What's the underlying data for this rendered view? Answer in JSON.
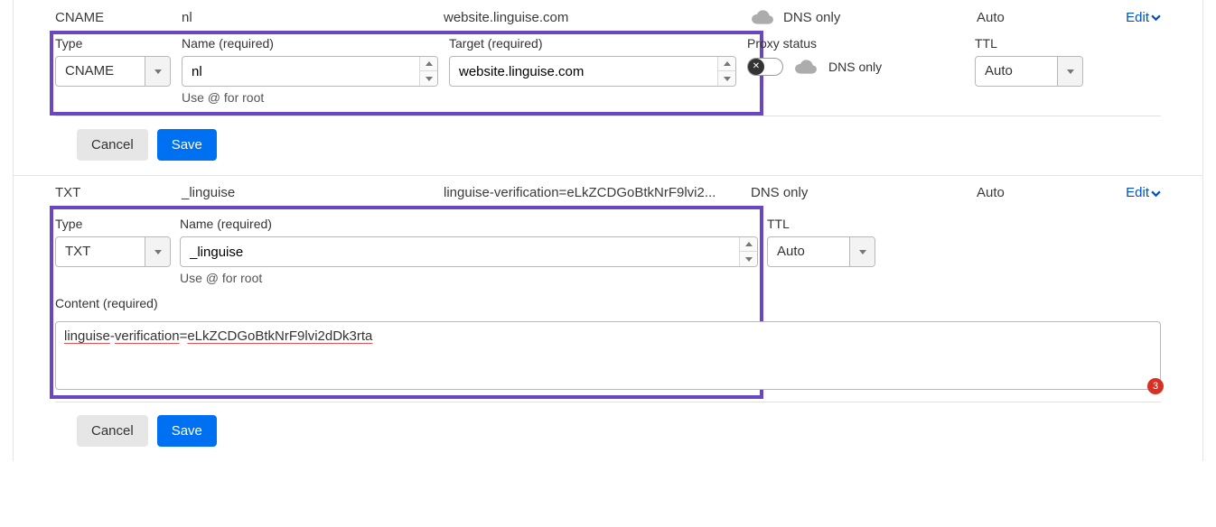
{
  "record1": {
    "summary": {
      "type": "CNAME",
      "name": "nl",
      "target": "website.linguise.com",
      "proxy_label": "DNS only",
      "ttl": "Auto",
      "edit": "Edit"
    },
    "form": {
      "type_label": "Type",
      "type_value": "CNAME",
      "name_label": "Name (required)",
      "name_value": "nl",
      "name_helper": "Use @ for root",
      "target_label": "Target (required)",
      "target_value": "website.linguise.com",
      "proxy_label": "Proxy status",
      "proxy_value": "DNS only",
      "ttl_label": "TTL",
      "ttl_value": "Auto",
      "cancel": "Cancel",
      "save": "Save"
    }
  },
  "record2": {
    "summary": {
      "type": "TXT",
      "name": "_linguise",
      "content_trunc": "linguise-verification=eLkZCDGoBtkNrF9lvi2...",
      "proxy_label": "DNS only",
      "ttl": "Auto",
      "edit": "Edit"
    },
    "form": {
      "type_label": "Type",
      "type_value": "TXT",
      "name_label": "Name (required)",
      "name_value": "_linguise",
      "name_helper": "Use @ for root",
      "ttl_label": "TTL",
      "ttl_value": "Auto",
      "content_label": "Content (required)",
      "content_underlined_1": "linguise",
      "content_plain_1": "-",
      "content_underlined_2": "verification",
      "content_plain_2": "=",
      "content_underlined_3": "eLkZCDGoBtkNrF9lvi2dDk3rta",
      "content_value": "linguise-verification=eLkZCDGoBtkNrF9lvi2dDk3rta",
      "counter": "3",
      "cancel": "Cancel",
      "save": "Save"
    }
  }
}
